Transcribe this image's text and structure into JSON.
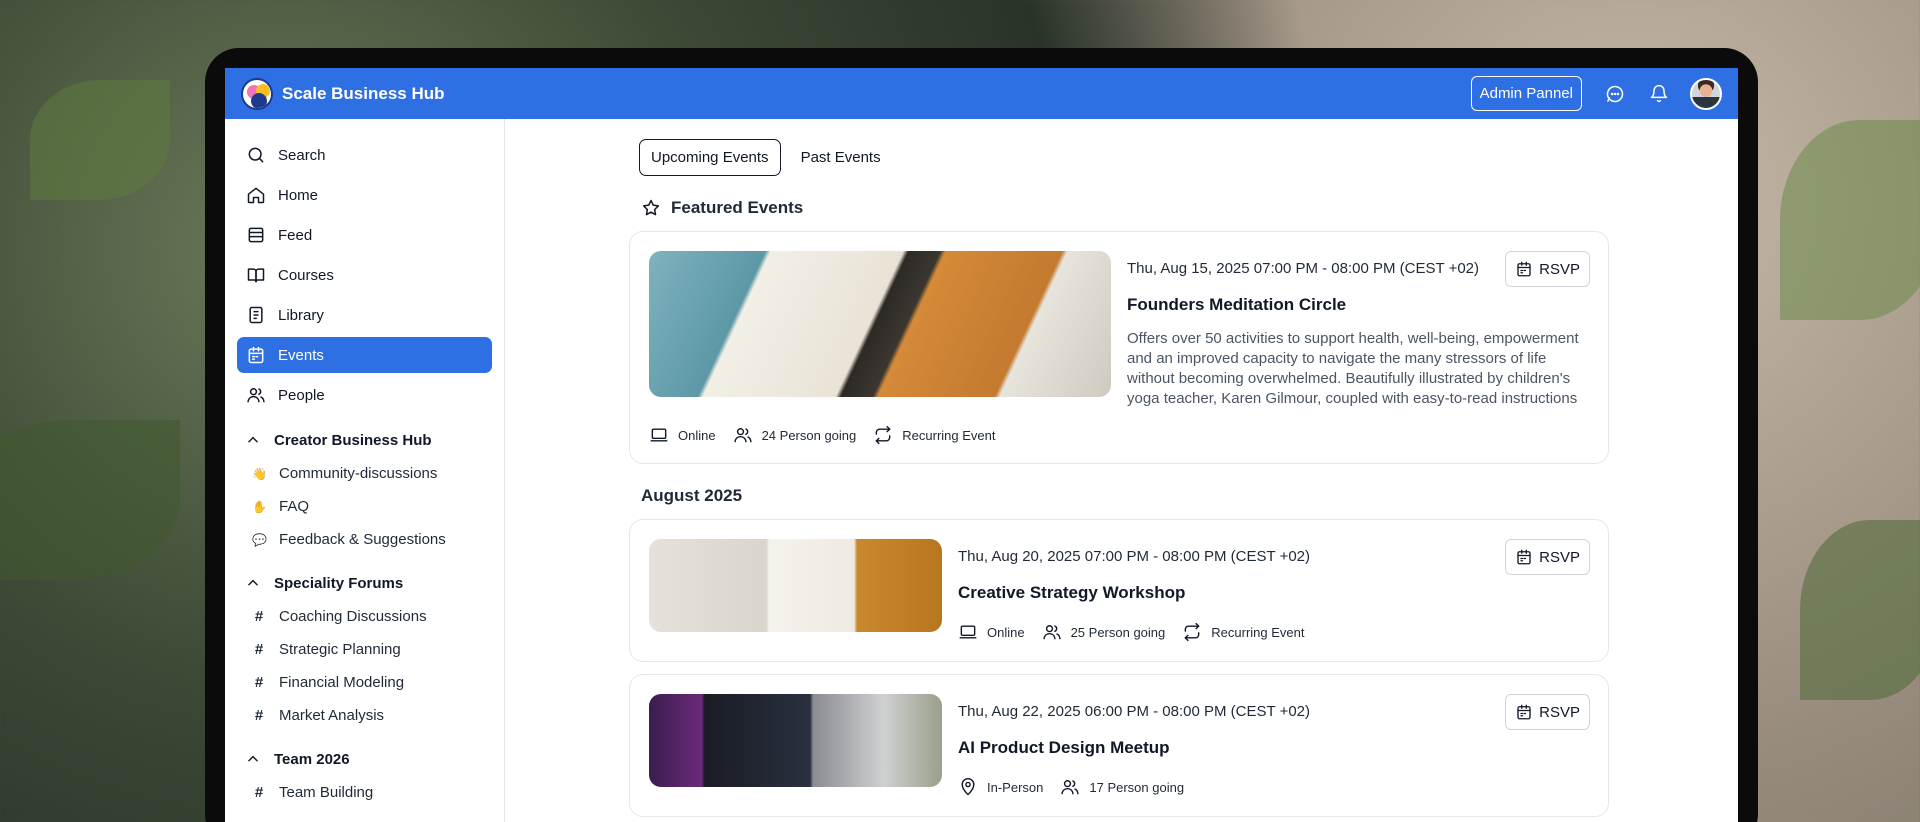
{
  "brand": {
    "name": "Scale Business Hub"
  },
  "topbar": {
    "admin_label": "Admin Pannel"
  },
  "sidebar": {
    "nav": [
      {
        "label": "Search",
        "icon": "search-icon"
      },
      {
        "label": "Home",
        "icon": "home-icon"
      },
      {
        "label": "Feed",
        "icon": "feed-icon"
      },
      {
        "label": "Courses",
        "icon": "book-icon"
      },
      {
        "label": "Library",
        "icon": "library-icon"
      },
      {
        "label": "Events",
        "icon": "calendar-icon",
        "active": true
      },
      {
        "label": "People",
        "icon": "people-icon"
      }
    ],
    "groups": [
      {
        "title": "Creator Business Hub",
        "items": [
          {
            "emoji": "👋",
            "label": "Community-discussions"
          },
          {
            "emoji": "✋",
            "label": "FAQ"
          },
          {
            "emoji": "💬",
            "label": "Feedback & Suggestions"
          }
        ]
      },
      {
        "title": "Speciality Forums",
        "items": [
          {
            "label": "Coaching Discussions"
          },
          {
            "label": "Strategic Planning"
          },
          {
            "label": "Financial Modeling"
          },
          {
            "label": "Market Analysis"
          }
        ]
      },
      {
        "title": "Team 2026",
        "items": [
          {
            "label": "Team Building"
          }
        ]
      }
    ]
  },
  "tabs": {
    "upcoming": "Upcoming Events",
    "past": "Past Events"
  },
  "featured": {
    "heading": "Featured Events",
    "event": {
      "date": "Thu, Aug 15, 2025 07:00 PM - 08:00 PM (CEST +02)",
      "title": "Founders Meditation Circle",
      "description": "Offers over 50 activities to support health, well-being, empowerment and an improved capacity to navigate the many stressors of life without becoming overwhelmed. Beautifully illustrated by children's yoga teacher, Karen Gilmour, coupled with easy-to-read instructions",
      "rsvp": "RSVP",
      "location": "Online",
      "going": "24 Person going",
      "recurring": "Recurring Event"
    }
  },
  "month": "August 2025",
  "events": [
    {
      "date": "Thu, Aug 20, 2025 07:00 PM - 08:00 PM (CEST +02)",
      "title": "Creative Strategy Workshop",
      "rsvp": "RSVP",
      "location": "Online",
      "going": "25 Person going",
      "recurring": "Recurring Event"
    },
    {
      "date": "Thu, Aug 22, 2025 06:00 PM - 08:00 PM (CEST +02)",
      "title": "AI Product Design Meetup",
      "rsvp": "RSVP",
      "location": "In-Person",
      "going": "17 Person going"
    }
  ],
  "colors": {
    "accent": "#2f6fe4",
    "device": "#0b0b0c"
  }
}
